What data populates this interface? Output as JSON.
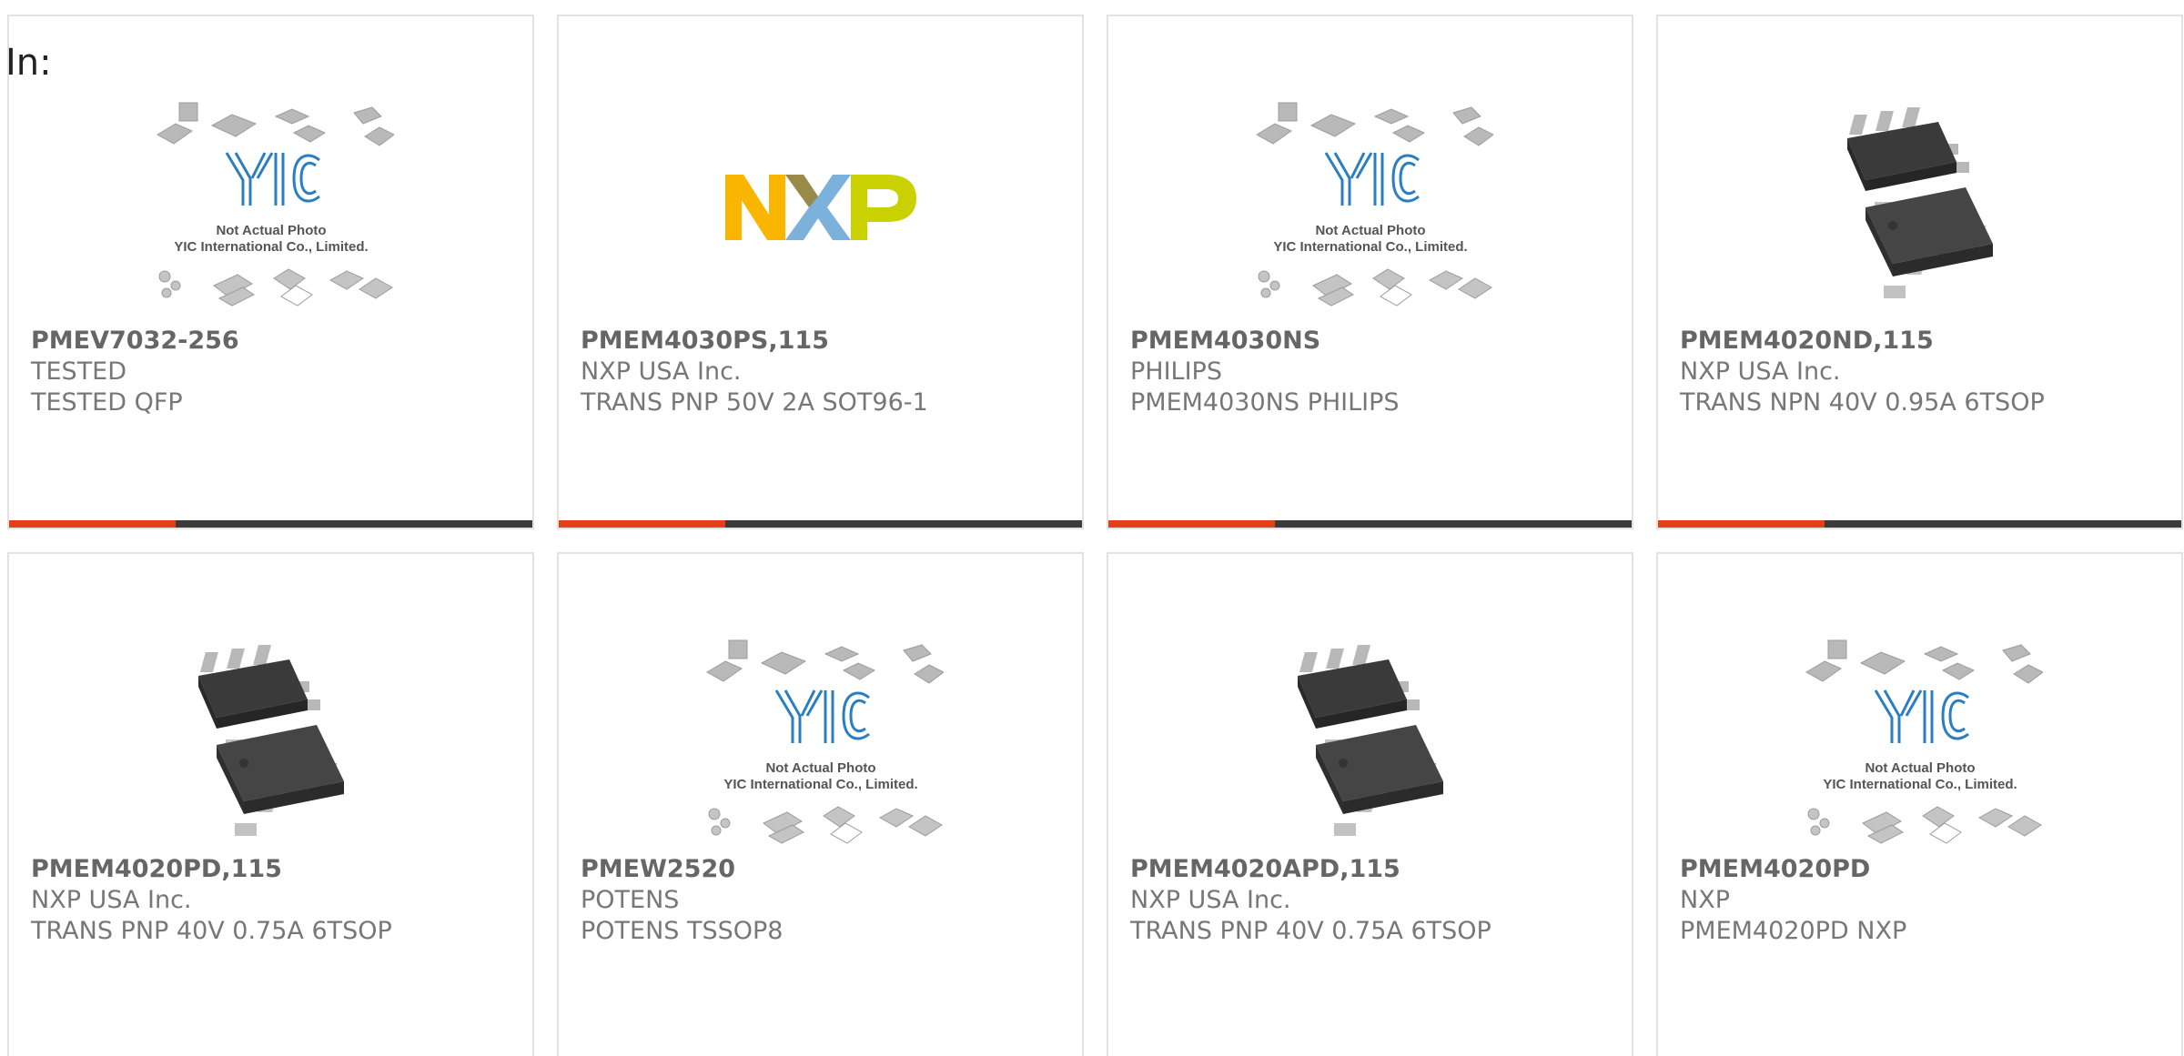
{
  "header": {
    "in_label": "In:"
  },
  "colors": {
    "accent": "#e3401a",
    "bar": "#3b3b3b",
    "border": "#e2e2e2",
    "text": "#666666"
  },
  "placeholder": {
    "line1": "Not Actual Photo",
    "line2": "YIC International Co., Limited."
  },
  "products": [
    {
      "part": "PMEV7032-256",
      "manufacturer": "TESTED",
      "description": "TESTED QFP",
      "image": "yic-placeholder"
    },
    {
      "part": "PMEM4030PS,115",
      "manufacturer": "NXP USA Inc.",
      "description": "TRANS PNP 50V 2A SOT96-1",
      "image": "nxp-logo"
    },
    {
      "part": "PMEM4030NS",
      "manufacturer": "PHILIPS",
      "description": "PMEM4030NS PHILIPS",
      "image": "yic-placeholder"
    },
    {
      "part": "PMEM4020ND,115",
      "manufacturer": "NXP USA Inc.",
      "description": "TRANS NPN 40V 0.95A 6TSOP",
      "image": "tsop-chip"
    },
    {
      "part": "PMEM4020PD,115",
      "manufacturer": "NXP USA Inc.",
      "description": "TRANS PNP 40V 0.75A 6TSOP",
      "image": "tsop-chip"
    },
    {
      "part": "PMEW2520",
      "manufacturer": "POTENS",
      "description": "POTENS TSSOP8",
      "image": "yic-placeholder"
    },
    {
      "part": "PMEM4020APD,115",
      "manufacturer": "NXP USA Inc.",
      "description": "TRANS PNP 40V 0.75A 6TSOP",
      "image": "tsop-chip"
    },
    {
      "part": "PMEM4020PD",
      "manufacturer": "NXP",
      "description": "PMEM4020PD NXP",
      "image": "yic-placeholder"
    }
  ]
}
